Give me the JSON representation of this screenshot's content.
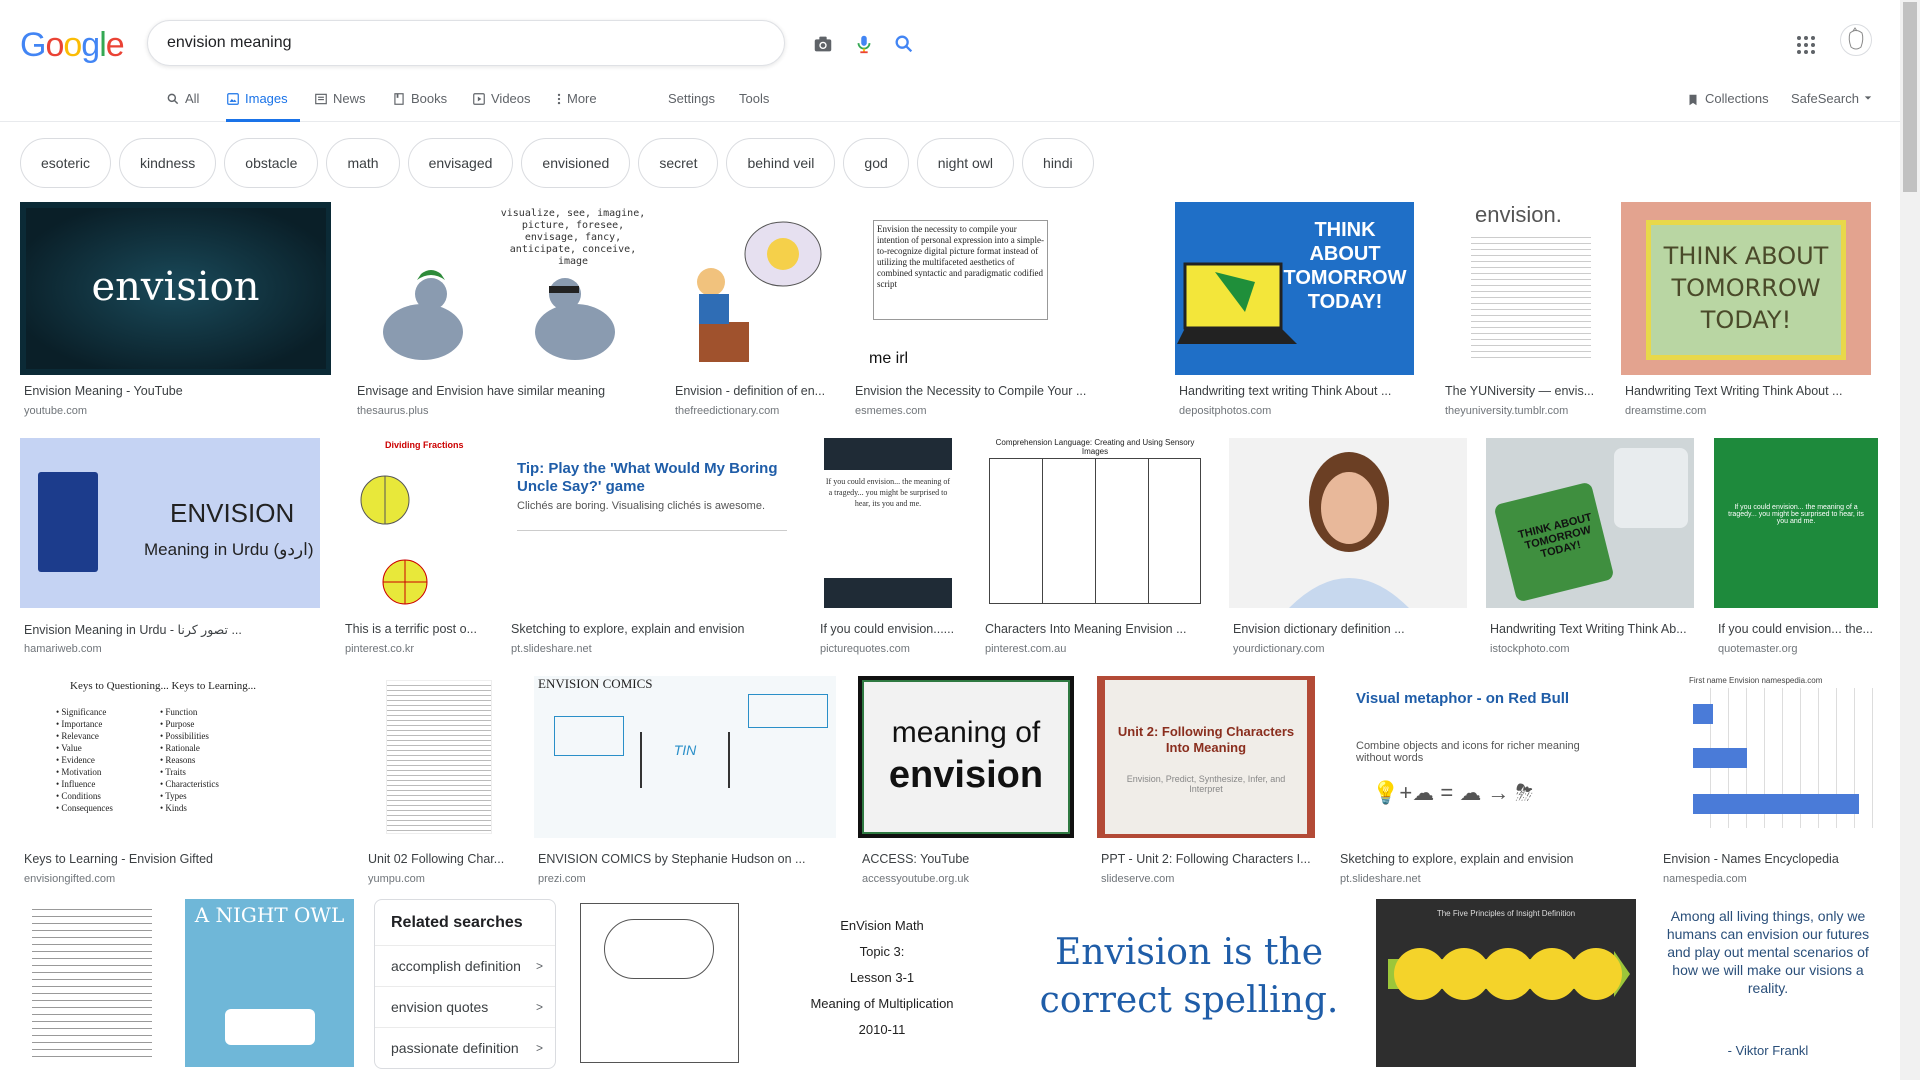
{
  "search": {
    "query": "envision meaning"
  },
  "logo_letters": [
    {
      "ch": "G",
      "color": "#4285F4"
    },
    {
      "ch": "o",
      "color": "#EA4335"
    },
    {
      "ch": "o",
      "color": "#FBBC05"
    },
    {
      "ch": "g",
      "color": "#4285F4"
    },
    {
      "ch": "l",
      "color": "#34A853"
    },
    {
      "ch": "e",
      "color": "#EA4335"
    }
  ],
  "tabs": {
    "all": "All",
    "images": "Images",
    "news": "News",
    "books": "Books",
    "videos": "Videos",
    "more": "More",
    "settings": "Settings",
    "tools": "Tools",
    "collections": "Collections",
    "safesearch": "SafeSearch"
  },
  "chips": [
    "esoteric",
    "kindness",
    "obstacle",
    "math",
    "envisaged",
    "envisioned",
    "secret",
    "behind veil",
    "god",
    "night owl",
    "hindi"
  ],
  "results": [
    {
      "title": "Envision Meaning - YouTube",
      "source": "youtube.com",
      "text": "envision"
    },
    {
      "title": "Envisage and Envision have similar meaning",
      "source": "thesaurus.plus",
      "text": "visualize, see, imagine, picture, foresee, envisage, fancy, anticipate, conceive, image"
    },
    {
      "title": "Envision - definition of en...",
      "source": "thefreedictionary.com",
      "text": ""
    },
    {
      "title": "Envision the Necessity to Compile Your ...",
      "source": "esmemes.com",
      "text": "me irl"
    },
    {
      "title": "Handwriting text writing Think About ...",
      "source": "depositphotos.com",
      "text": "THINK ABOUT TOMORROW TODAY!"
    },
    {
      "title": "The YUNiversity — envis...",
      "source": "theyuniversity.tumblr.com",
      "text": "envision."
    },
    {
      "title": "Handwriting Text Writing Think About ...",
      "source": "dreamstime.com",
      "text": "THINK ABOUT TOMORROW TODAY!"
    },
    {
      "title": "Envision Meaning in Urdu - تصور کرنا ...",
      "source": "hamariweb.com",
      "text": "ENVISION",
      "text2": "Meaning in Urdu (اردو)"
    },
    {
      "title": "This is a terrific post o...",
      "source": "pinterest.co.kr",
      "text": "Dividing Fractions"
    },
    {
      "title": "Sketching to explore, explain and envision",
      "source": "pt.slideshare.net",
      "text": "Tip: Play the 'What Would My Boring Uncle Say?' game"
    },
    {
      "title": "If you could envision......",
      "source": "picturequotes.com",
      "text": "If you could envision... the meaning of a tragedy... you might be surprised to hear, its you and me."
    },
    {
      "title": "Characters Into Meaning Envision ...",
      "source": "pinterest.com.au",
      "text": "Comprehension Language: Creating and Using Sensory Images"
    },
    {
      "title": "Envision dictionary definition ...",
      "source": "yourdictionary.com",
      "text": ""
    },
    {
      "title": "Handwriting Text Writing Think Ab...",
      "source": "istockphoto.com",
      "text": "THINK ABOUT TOMORROW TODAY!"
    },
    {
      "title": "If you could envision... the...",
      "source": "quotemaster.org",
      "text": "If you could envision... the meaning of a tragedy... you might be surprised to hear, its you and me."
    },
    {
      "title": "Keys to Learning - Envision Gifted",
      "source": "envisiongifted.com",
      "text": "Keys to Questioning... Keys to Learning..."
    },
    {
      "title": "Unit 02 Following Char...",
      "source": "yumpu.com",
      "text": ""
    },
    {
      "title": "ENVISION COMICS by Stephanie Hudson on ...",
      "source": "prezi.com",
      "text": "ENVISION COMICS"
    },
    {
      "title": "ACCESS: YouTube",
      "source": "accessyoutube.org.uk",
      "text": "meaning of",
      "text2": "envision"
    },
    {
      "title": "PPT - Unit 2: Following Characters I...",
      "source": "slideserve.com",
      "text": "Unit 2: Following Characters Into Meaning",
      "text2": "Envision, Predict, Synthesize, Infer, and Interpret"
    },
    {
      "title": "Sketching to explore, explain and envision",
      "source": "pt.slideshare.net",
      "text": "Visual metaphor - on Red Bull",
      "text2": "Combine objects and icons for richer meaning without words"
    },
    {
      "title": "Envision - Names Encyclopedia",
      "source": "namespedia.com",
      "text": "First name Envision namespedia.com"
    }
  ],
  "bottom_row": {
    "night_owl": "A NIGHT OWL",
    "math_lines": [
      "EnVision Math",
      "Topic 3:",
      "Lesson 3-1",
      "Meaning of Multiplication",
      "2010-11"
    ],
    "spelling": "Envision is the correct spelling.",
    "insight": "The Five Principles of Insight Definition",
    "quote": "Among all living things, only we humans can envision our futures and play out mental scenarios of how we will make our visions a reality.",
    "quote_author": "- Viktor Frankl"
  },
  "related": {
    "title": "Related searches",
    "items": [
      "accomplish definition",
      "envision quotes",
      "passionate definition"
    ]
  },
  "colors": {
    "accent": "#1a73e8",
    "text_secondary": "#70757a"
  }
}
